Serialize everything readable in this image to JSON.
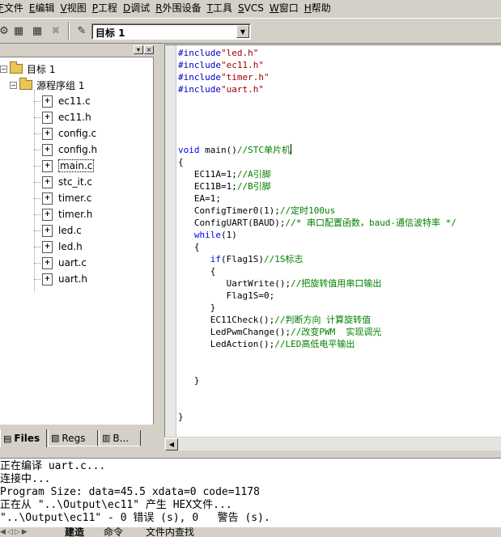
{
  "menu": [
    {
      "acc": "F",
      "label": "文件"
    },
    {
      "acc": "E",
      "label": "编辑"
    },
    {
      "acc": "V",
      "label": "视图"
    },
    {
      "acc": "P",
      "label": "工程"
    },
    {
      "acc": "D",
      "label": "调试"
    },
    {
      "acc": "R",
      "label": "外围设备"
    },
    {
      "acc": "T",
      "label": "工具"
    },
    {
      "acc": "S",
      "label": "VCS",
      "acc_first": true
    },
    {
      "acc": "W",
      "label": "窗口"
    },
    {
      "acc": "H",
      "label": "帮助"
    }
  ],
  "toolbar": {
    "target_value": "目标 1",
    "icons": [
      "build-icon",
      "rebuild-icon",
      "batch-build-icon",
      "stop-build-icon",
      "options-wand-icon"
    ]
  },
  "project": {
    "root": "目标 1",
    "group": "源程序组 1",
    "files": [
      "ec11.c",
      "ec11.h",
      "config.c",
      "config.h",
      "main.c",
      "stc_it.c",
      "timer.c",
      "timer.h",
      "led.c",
      "led.h",
      "uart.c",
      "uart.h"
    ],
    "selected_file": "main.c",
    "tabs": [
      "Files",
      "Regs",
      "B..."
    ]
  },
  "editor": {
    "lines": [
      [
        {
          "c": "kw-pre",
          "t": "#include"
        },
        {
          "c": "str",
          "t": "\"led.h\""
        }
      ],
      [
        {
          "c": "kw-pre",
          "t": "#include"
        },
        {
          "c": "str",
          "t": "\"ec11.h\""
        }
      ],
      [
        {
          "c": "kw-pre",
          "t": "#include"
        },
        {
          "c": "str",
          "t": "\"timer.h\""
        }
      ],
      [
        {
          "c": "kw-pre",
          "t": "#include"
        },
        {
          "c": "str",
          "t": "\"uart.h\""
        }
      ],
      [],
      [],
      [],
      [],
      [
        {
          "c": "kw",
          "t": "void"
        },
        {
          "c": "",
          "t": " main()"
        },
        {
          "c": "cm",
          "t": "//STC单片机"
        },
        {
          "c": "caret",
          "t": ""
        }
      ],
      [
        {
          "c": "",
          "t": "{"
        }
      ],
      [
        {
          "c": "",
          "t": "   EC11A=1;"
        },
        {
          "c": "cm",
          "t": "//A引脚"
        }
      ],
      [
        {
          "c": "",
          "t": "   EC11B=1;"
        },
        {
          "c": "cm",
          "t": "//B引脚"
        }
      ],
      [
        {
          "c": "",
          "t": "   EA=1;"
        }
      ],
      [
        {
          "c": "",
          "t": "   ConfigTimer0(1);"
        },
        {
          "c": "cm",
          "t": "//定时100us"
        }
      ],
      [
        {
          "c": "",
          "t": "   ConfigUART(BAUD);"
        },
        {
          "c": "cm",
          "t": "//* 串口配置函数，baud-通信波特率 */"
        }
      ],
      [
        {
          "c": "",
          "t": "   "
        },
        {
          "c": "kw",
          "t": "while"
        },
        {
          "c": "",
          "t": "(1)"
        }
      ],
      [
        {
          "c": "",
          "t": "   {"
        }
      ],
      [
        {
          "c": "",
          "t": "      "
        },
        {
          "c": "kw",
          "t": "if"
        },
        {
          "c": "",
          "t": "(Flag1S)"
        },
        {
          "c": "cm",
          "t": "//1S标志"
        }
      ],
      [
        {
          "c": "",
          "t": "      {"
        }
      ],
      [
        {
          "c": "",
          "t": "         UartWrite();"
        },
        {
          "c": "cm",
          "t": "//把旋转值用串口输出"
        }
      ],
      [
        {
          "c": "",
          "t": "         Flag1S=0;"
        }
      ],
      [
        {
          "c": "",
          "t": "      }"
        }
      ],
      [
        {
          "c": "",
          "t": "      EC11Check();"
        },
        {
          "c": "cm",
          "t": "//判断方向 计算旋转值"
        }
      ],
      [
        {
          "c": "",
          "t": "      LedPwmChange();"
        },
        {
          "c": "cm",
          "t": "//改变PWM  实现调光"
        }
      ],
      [
        {
          "c": "",
          "t": "      LedAction();"
        },
        {
          "c": "cm",
          "t": "//LED高低电平输出"
        }
      ],
      [],
      [],
      [
        {
          "c": "",
          "t": "   }"
        }
      ],
      [],
      [],
      [
        {
          "c": "",
          "t": "}"
        }
      ]
    ]
  },
  "output": {
    "lines": [
      "正在编译 uart.c...",
      "连接中...",
      "Program Size: data=45.5 xdata=0 code=1178",
      "正在从 \"..\\Output\\ec11\" 产生 HEX文件...",
      "\"..\\Output\\ec11\" - 0 错误 (s), 0   警告 (s)."
    ],
    "tabs": [
      "建造",
      "命令",
      "文件内查找"
    ]
  }
}
